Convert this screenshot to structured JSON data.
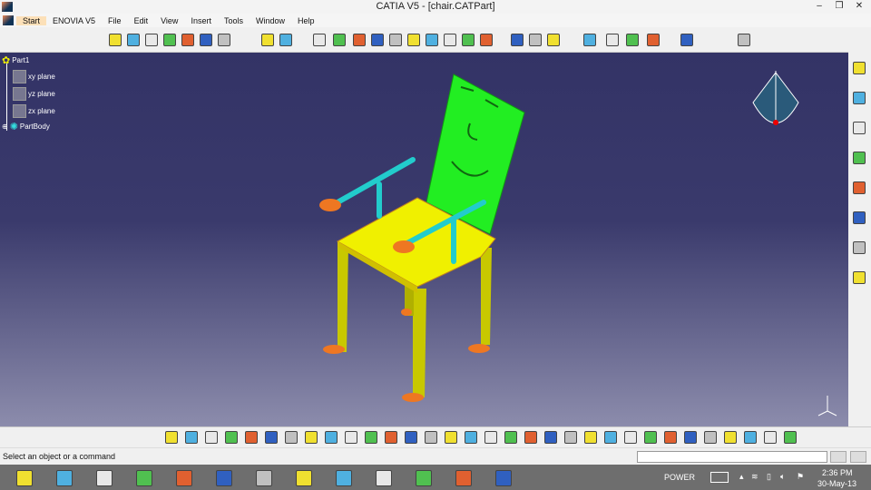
{
  "window": {
    "title": "CATIA V5 - [chair.CATPart]",
    "minimize": "–",
    "restore": "❒",
    "close": "✕"
  },
  "menu": [
    {
      "label": "Start"
    },
    {
      "label": "ENOVIA V5"
    },
    {
      "label": "File"
    },
    {
      "label": "Edit"
    },
    {
      "label": "View"
    },
    {
      "label": "Insert"
    },
    {
      "label": "Tools"
    },
    {
      "label": "Window"
    },
    {
      "label": "Help"
    }
  ],
  "tree": {
    "root": "Part1",
    "items": [
      {
        "label": "xy plane"
      },
      {
        "label": "yz plane"
      },
      {
        "label": "zx plane"
      },
      {
        "label": "PartBody"
      }
    ]
  },
  "top_icons": [
    "sketch-based-features-icon",
    "dress-up-features-icon",
    "surface-features-icon",
    "transform-icon",
    "boolean-icon",
    "axis-system-icon",
    "material-icon",
    "analysis-icon",
    "table-icon",
    "pad-icon",
    "pocket-icon",
    "shaft-icon",
    "groove-icon",
    "hole-icon",
    "rib-icon",
    "slot-icon",
    "stiffener-icon",
    "multi-section-icon",
    "point-icon",
    "line-icon",
    "plane-icon",
    "measure-icon",
    "constraint-icon",
    "grid-icon",
    "snap-icon",
    "select-icon",
    "annotation-icon",
    "paint-icon"
  ],
  "right_icons": [
    "sketcher-icon",
    "stop-icon",
    "pcs-icon",
    "edit-icon",
    "knowledge-icon",
    "apply-material-icon",
    "catalog-icon",
    "more-icon"
  ],
  "bottom_icons": [
    "update-icon",
    "new-icon",
    "open-icon",
    "save-icon",
    "print-icon",
    "cut-icon",
    "copy-icon",
    "paste-icon",
    "undo-icon",
    "redo-icon",
    "whats-this-icon",
    "fly-icon",
    "fit-all-icon",
    "pan-icon",
    "rotate-icon",
    "zoom-in-icon",
    "zoom-out-icon",
    "normal-view-icon",
    "multi-view-icon",
    "iso-view-icon",
    "shading-icon",
    "hide-show-icon",
    "swap-icon",
    "sketch-analysis-icon",
    "sketch-solving-icon",
    "render-icon",
    "apply-material-icon",
    "axis-icon",
    "catalog-icon",
    "feature-icon",
    "tool-icon",
    "user-icon"
  ],
  "status": {
    "text": "Select an object or a command",
    "input": ""
  },
  "taskbar": {
    "apps": [
      "internet-explorer-icon",
      "file-explorer-icon",
      "globe-icon",
      "opera-icon",
      "media-icon",
      "chrome-icon",
      "firefox-icon",
      "notes-icon",
      "catia-editor-icon",
      "vlc-icon",
      "app-icon",
      "player-icon",
      "catia-icon"
    ],
    "power": "POWER",
    "time": "2:36 PM",
    "date": "30-May-13"
  },
  "colors": {
    "viewport_top": "#333366",
    "viewport_bottom": "#8c8cac",
    "seat": "#f0f000",
    "back": "#22ee22",
    "arm": "#22cccc",
    "legs": "#cccc00",
    "hands": "#ee7722"
  },
  "compass_logo": "DS CATIA"
}
